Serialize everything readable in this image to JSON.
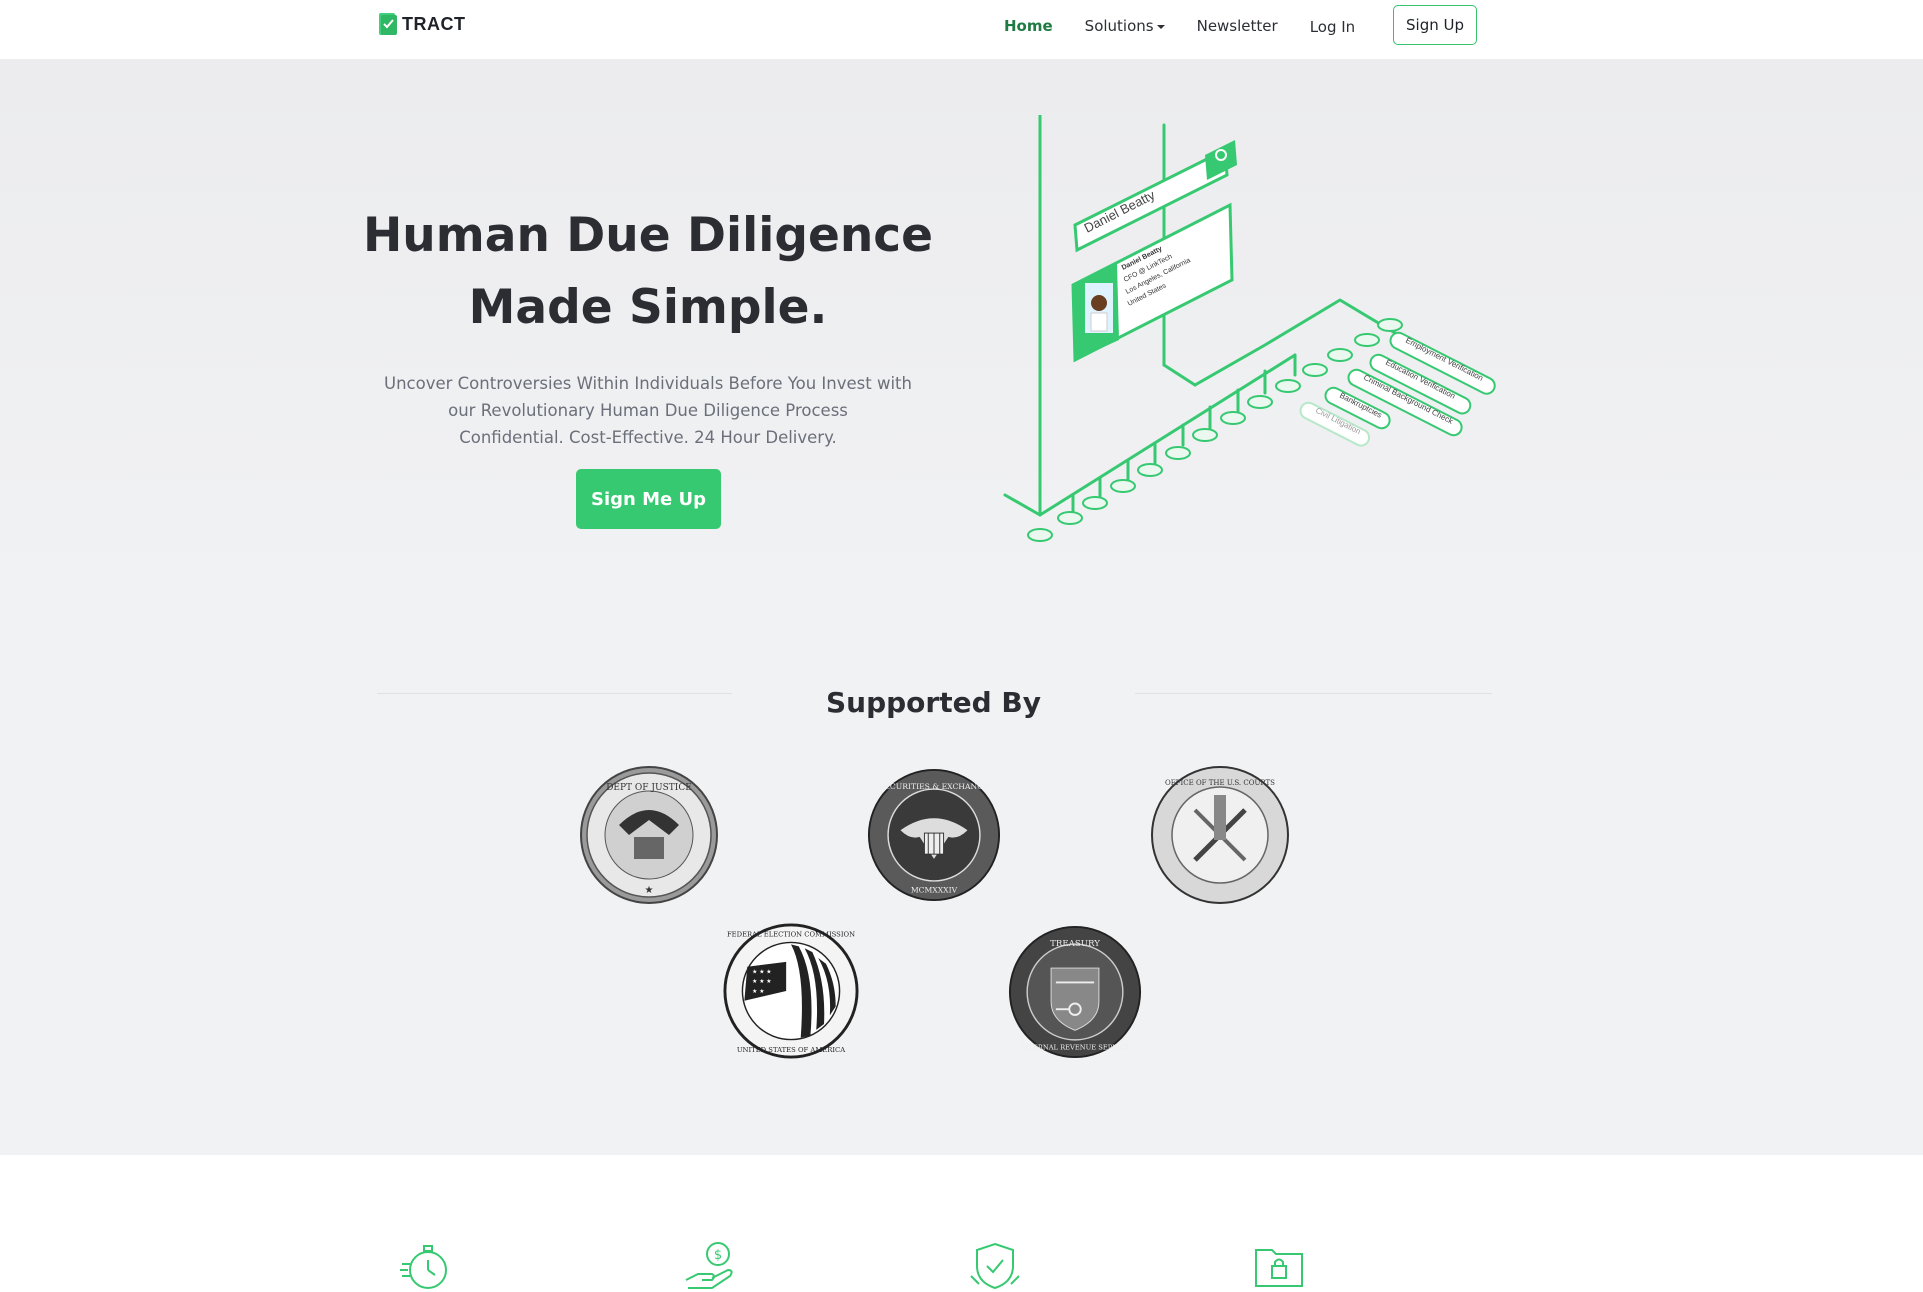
{
  "nav": {
    "logo_text": "TRACT",
    "links": [
      {
        "label": "Home",
        "active": true
      },
      {
        "label": "Solutions",
        "dropdown": true
      },
      {
        "label": "Newsletter"
      },
      {
        "label": "Log In"
      }
    ],
    "signup_label": "Sign Up"
  },
  "hero": {
    "title_line1": "Human Due Diligence",
    "title_line2": "Made Simple.",
    "subtitle_line1": "Uncover Controversies Within Individuals Before You Invest with",
    "subtitle_line2": "our Revolutionary Human Due Diligence Process",
    "subtitle_line3": "Confidential. Cost-Effective. 24 Hour Delivery.",
    "cta_label": "Sign Me Up",
    "illustration": {
      "search_text": "Daniel Beatty",
      "profile_name": "Daniel Beatty",
      "profile_line1": "CFO @ LinkTech",
      "profile_line2": "Los Angeles, California",
      "profile_line3": "United States",
      "tags": [
        "Employment Verification",
        "Education Verification",
        "Criminal Background Check",
        "Bankruptcies",
        "Civil Litigation"
      ]
    }
  },
  "supported": {
    "title": "Supported By",
    "seals": [
      {
        "name": "department-of-justice-seal",
        "text": "DEPARTMENT OF JUSTICE"
      },
      {
        "name": "sec-seal",
        "text": "U.S. SECURITIES AND EXCHANGE COMMISSION"
      },
      {
        "name": "us-courts-seal",
        "text": "ADMINISTRATIVE OFFICE OF THE UNITED STATES COURTS"
      },
      {
        "name": "fec-seal",
        "text": "FEDERAL ELECTION COMMISSION"
      },
      {
        "name": "irs-seal",
        "text": "TREASURY INTERNAL REVENUE SERVICE"
      }
    ]
  },
  "colors": {
    "accent": "#37c971",
    "active_link": "#1f7a43",
    "hero_bg": "#f1f2f4",
    "text_dark": "#2b2d33",
    "text_muted": "#6b6f7a"
  },
  "features": {
    "icons": [
      "stopwatch-icon",
      "money-hand-icon",
      "shield-check-icon",
      "secure-folder-icon"
    ]
  }
}
